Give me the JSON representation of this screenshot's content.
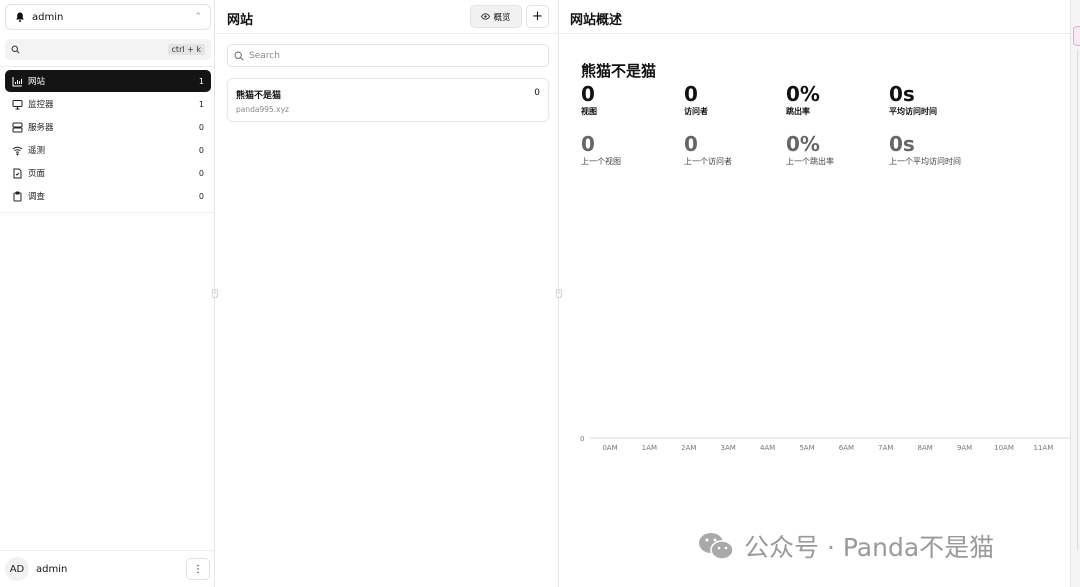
{
  "sidebar": {
    "workspace_name": "admin",
    "search_shortcut": "ctrl + k",
    "nav": [
      {
        "label": "网站",
        "count": "1",
        "icon": "chart-icon",
        "active": true
      },
      {
        "label": "监控器",
        "count": "1",
        "icon": "monitor-icon",
        "active": false
      },
      {
        "label": "服务器",
        "count": "0",
        "icon": "server-icon",
        "active": false
      },
      {
        "label": "遥测",
        "count": "0",
        "icon": "wifi-icon",
        "active": false
      },
      {
        "label": "页面",
        "count": "0",
        "icon": "page-icon",
        "active": false
      },
      {
        "label": "调查",
        "count": "0",
        "icon": "clipboard-icon",
        "active": false
      }
    ],
    "user": {
      "initials": "AD",
      "name": "admin",
      "menu_glyph": "⋮"
    }
  },
  "websites": {
    "title": "网站",
    "overview_label": "概览",
    "add_glyph": "+",
    "search_placeholder": "Search",
    "items": [
      {
        "name": "熊猫不是猫",
        "domain": "panda995.xyz",
        "count": "0"
      }
    ]
  },
  "overview": {
    "title": "网站概述",
    "site_name": "熊猫不是猫",
    "stats": [
      {
        "value": "0",
        "label": "视图"
      },
      {
        "value": "0",
        "label": "访问者"
      },
      {
        "value": "0%",
        "label": "跳出率"
      },
      {
        "value": "0s",
        "label": "平均访问时间"
      }
    ],
    "previous_stats": [
      {
        "value": "0",
        "label": "上一个视图"
      },
      {
        "value": "0",
        "label": "上一个访问者"
      },
      {
        "value": "0%",
        "label": "上一个跳出率"
      },
      {
        "value": "0s",
        "label": "上一个平均访问时间"
      }
    ]
  },
  "chart_data": {
    "type": "line",
    "categories": [
      "0AM",
      "1AM",
      "2AM",
      "3AM",
      "4AM",
      "5AM",
      "6AM",
      "7AM",
      "8AM",
      "9AM",
      "10AM",
      "11AM"
    ],
    "values": [
      0,
      0,
      0,
      0,
      0,
      0,
      0,
      0,
      0,
      0,
      0,
      0
    ],
    "y_ticks": [
      "0"
    ],
    "ylim": [
      0,
      0
    ]
  },
  "watermark": {
    "text": "公众号 · Panda不是猫",
    "icon": "wechat-icon"
  }
}
